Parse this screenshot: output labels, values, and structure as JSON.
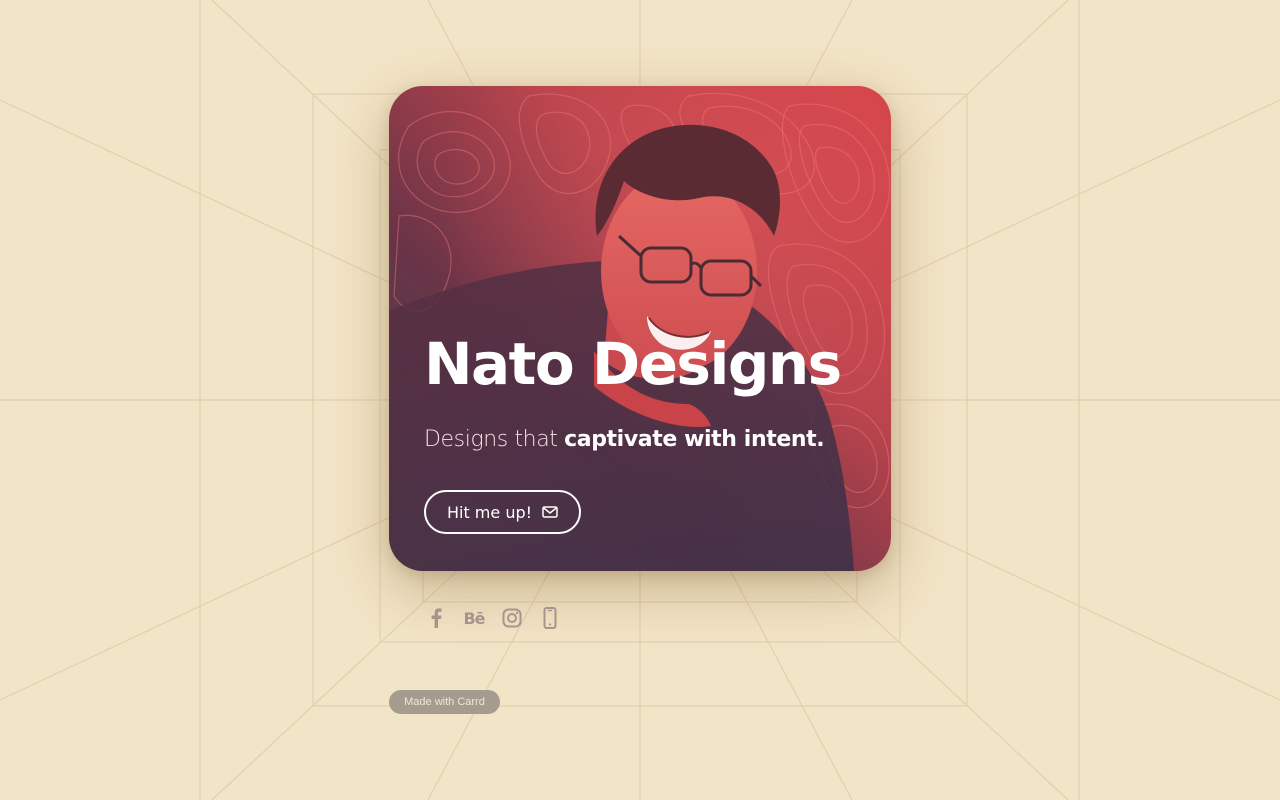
{
  "page": {
    "background_color": "#f2e4c6",
    "accent_color": "#d44147"
  },
  "card": {
    "title": "Nato Designs",
    "tagline_light": "Designs that ",
    "tagline_bold": "captivate with intent.",
    "cta_label": "Hit me up!",
    "cta_icon": "mail-icon",
    "photo": "smiling-man-with-glasses-photo"
  },
  "socials": [
    {
      "name": "facebook-icon"
    },
    {
      "name": "behance-icon",
      "text": "Bē"
    },
    {
      "name": "instagram-icon"
    },
    {
      "name": "phone-icon"
    }
  ],
  "footer": {
    "badge": "Made with Carrd"
  }
}
